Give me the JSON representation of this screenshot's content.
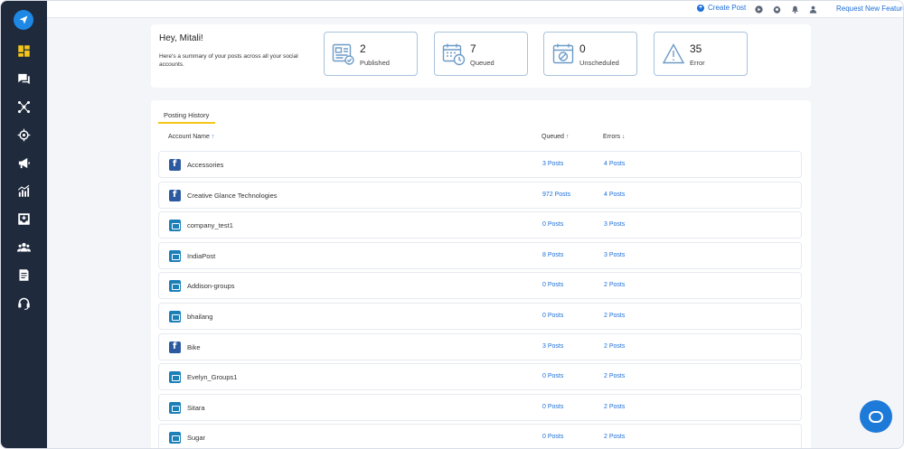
{
  "topbar": {
    "create_post": "Create Post",
    "request_feature": "Request New Feature"
  },
  "sidebar": {
    "items": [
      {
        "icon": "dashboard-icon"
      },
      {
        "icon": "messages-icon"
      },
      {
        "icon": "network-icon"
      },
      {
        "icon": "target-icon"
      },
      {
        "icon": "megaphone-icon"
      },
      {
        "icon": "analytics-icon"
      },
      {
        "icon": "inbox-icon"
      },
      {
        "icon": "team-icon"
      },
      {
        "icon": "document-icon"
      },
      {
        "icon": "support-icon"
      }
    ]
  },
  "summary": {
    "greeting": "Hey, Mitali!",
    "subtitle": "Here's a summary of your posts across all your social accounts.",
    "stats": [
      {
        "value": "2",
        "label": "Published",
        "icon": "published-icon"
      },
      {
        "value": "7",
        "label": "Queued",
        "icon": "queued-icon"
      },
      {
        "value": "0",
        "label": "Unscheduled",
        "icon": "unscheduled-icon"
      },
      {
        "value": "35",
        "label": "Error",
        "icon": "error-icon"
      }
    ]
  },
  "history": {
    "tab": "Posting History",
    "columns": {
      "account": "Account Name",
      "queued": "Queued",
      "errors": "Errors",
      "account_arrow": "↑",
      "queued_arrow": "↑",
      "errors_arrow": "↓"
    },
    "rows": [
      {
        "type": "facebook",
        "name": "Accessories",
        "queued": "3 Posts",
        "errors": "4 Posts"
      },
      {
        "type": "facebook",
        "name": "Creative Glance Technologies",
        "queued": "972 Posts",
        "errors": "4 Posts"
      },
      {
        "type": "company",
        "name": "company_test1",
        "queued": "0 Posts",
        "errors": "3 Posts"
      },
      {
        "type": "company",
        "name": "IndiaPost",
        "queued": "8 Posts",
        "errors": "3 Posts"
      },
      {
        "type": "company",
        "name": "Addison-groups",
        "queued": "0 Posts",
        "errors": "2 Posts"
      },
      {
        "type": "company",
        "name": "bhailang",
        "queued": "0 Posts",
        "errors": "2 Posts"
      },
      {
        "type": "facebook",
        "name": "Bike",
        "queued": "3 Posts",
        "errors": "2 Posts"
      },
      {
        "type": "company",
        "name": "Evelyn_Groups1",
        "queued": "0 Posts",
        "errors": "2 Posts"
      },
      {
        "type": "company",
        "name": "Sitara",
        "queued": "0 Posts",
        "errors": "2 Posts"
      },
      {
        "type": "company",
        "name": "Sugar",
        "queued": "0 Posts",
        "errors": "2 Posts"
      }
    ]
  },
  "colors": {
    "sidebar_bg": "#1f2a3d",
    "accent_blue": "#1e6fd9",
    "active_yellow": "#f5c518"
  }
}
